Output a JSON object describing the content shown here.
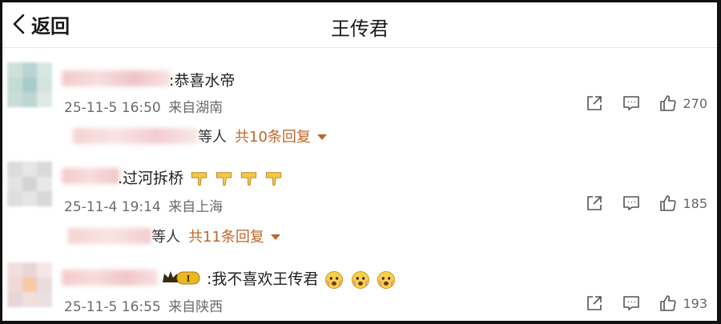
{
  "header": {
    "back_label": "返回",
    "title": "王传君"
  },
  "comments": [
    {
      "text": ":恭喜水帝",
      "time": "25-11-5 16:50",
      "location": "来自湖南",
      "likes": "270",
      "reply_suffix": "等人",
      "reply_link": "共10条回复"
    },
    {
      "text": ".过河拆桥",
      "time": "25-11-4 19:14",
      "location": "来自上海",
      "likes": "185",
      "reply_suffix": "等人",
      "reply_link": "共11条回复"
    },
    {
      "text": ":我不喜欢王传君",
      "time": "25-11-5 16:55",
      "location": "来自陕西",
      "likes": "193"
    }
  ],
  "icons": {
    "share": "share-icon",
    "comment": "comment-icon",
    "like": "thumbs-up-icon",
    "thumbs_down": "thumbs-down-emoji",
    "scared": "scared-face-emoji",
    "crown": "crown-badge-icon"
  },
  "colors": {
    "reply_link": "#c0672b",
    "meta": "#6b6b6b",
    "badge_gold": "#e8b923"
  }
}
